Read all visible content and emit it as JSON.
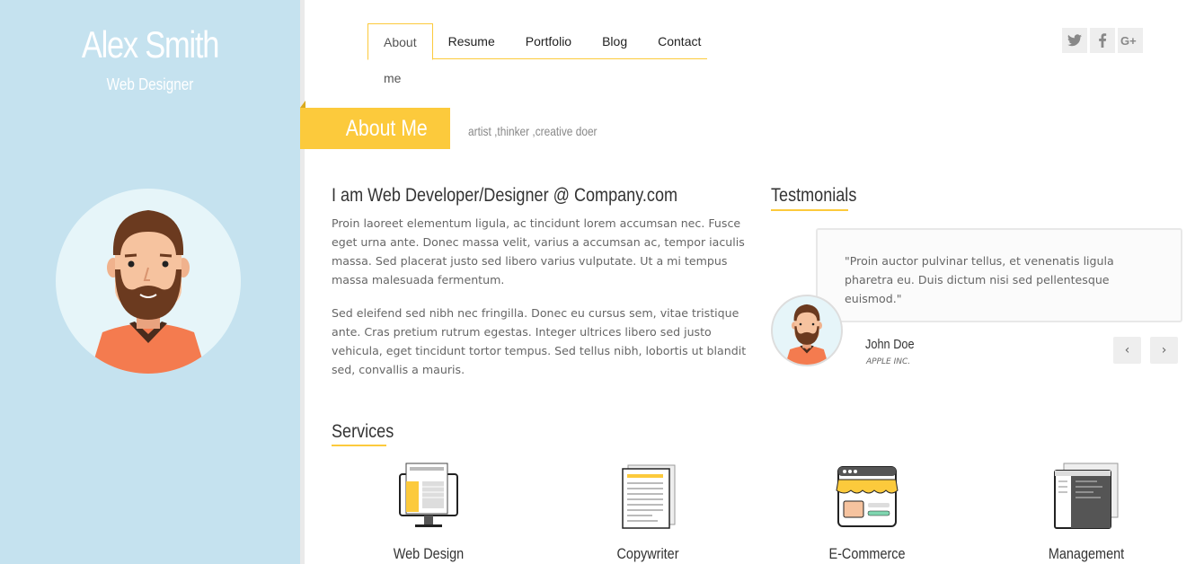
{
  "profile": {
    "name": "Alex Smith",
    "role": "Web Designer"
  },
  "nav": {
    "items": [
      "About me",
      "Resume",
      "Portfolio",
      "Blog",
      "Contact"
    ],
    "active": "About me"
  },
  "social": [
    "twitter-icon",
    "facebook-icon",
    "google-plus-icon"
  ],
  "section": {
    "title": "About Me",
    "subtitle": "artist ,thinker ,creative doer"
  },
  "about": {
    "heading": "I am Web Developer/Designer @ Company.com",
    "paragraphs": [
      "Proin laoreet elementum ligula, ac tincidunt lorem accumsan nec. Fusce eget urna ante. Donec massa velit, varius a accumsan ac, tempor iaculis massa. Sed placerat justo sed libero varius vulputate. Ut a mi tempus massa malesuada fermentum.",
      "Sed eleifend sed nibh nec fringilla. Donec eu cursus sem, vitae tristique ante. Cras pretium rutrum egestas. Integer ultrices libero sed justo vehicula, eget tincidunt tortor tempus. Sed tellus nibh, lobortis ut blandit sed, convallis a mauris."
    ]
  },
  "testimonials": {
    "heading": "Testmonials",
    "quote": "\"Proin auctor pulvinar tellus, et venenatis ligula pharetra eu. Duis dictum nisi sed pellentesque euismod.\"",
    "author": "John Doe",
    "company": "APPLE INC.",
    "prev_label": "‹",
    "next_label": "›"
  },
  "services": {
    "heading": "Services",
    "items": [
      "Web Design",
      "Copywriter",
      "E-Commerce",
      "Management"
    ]
  },
  "colors": {
    "accent": "#fcca3c",
    "sidebar": "#c5e2ef",
    "shirt": "#f47b4f",
    "hair": "#6b3a1f"
  }
}
